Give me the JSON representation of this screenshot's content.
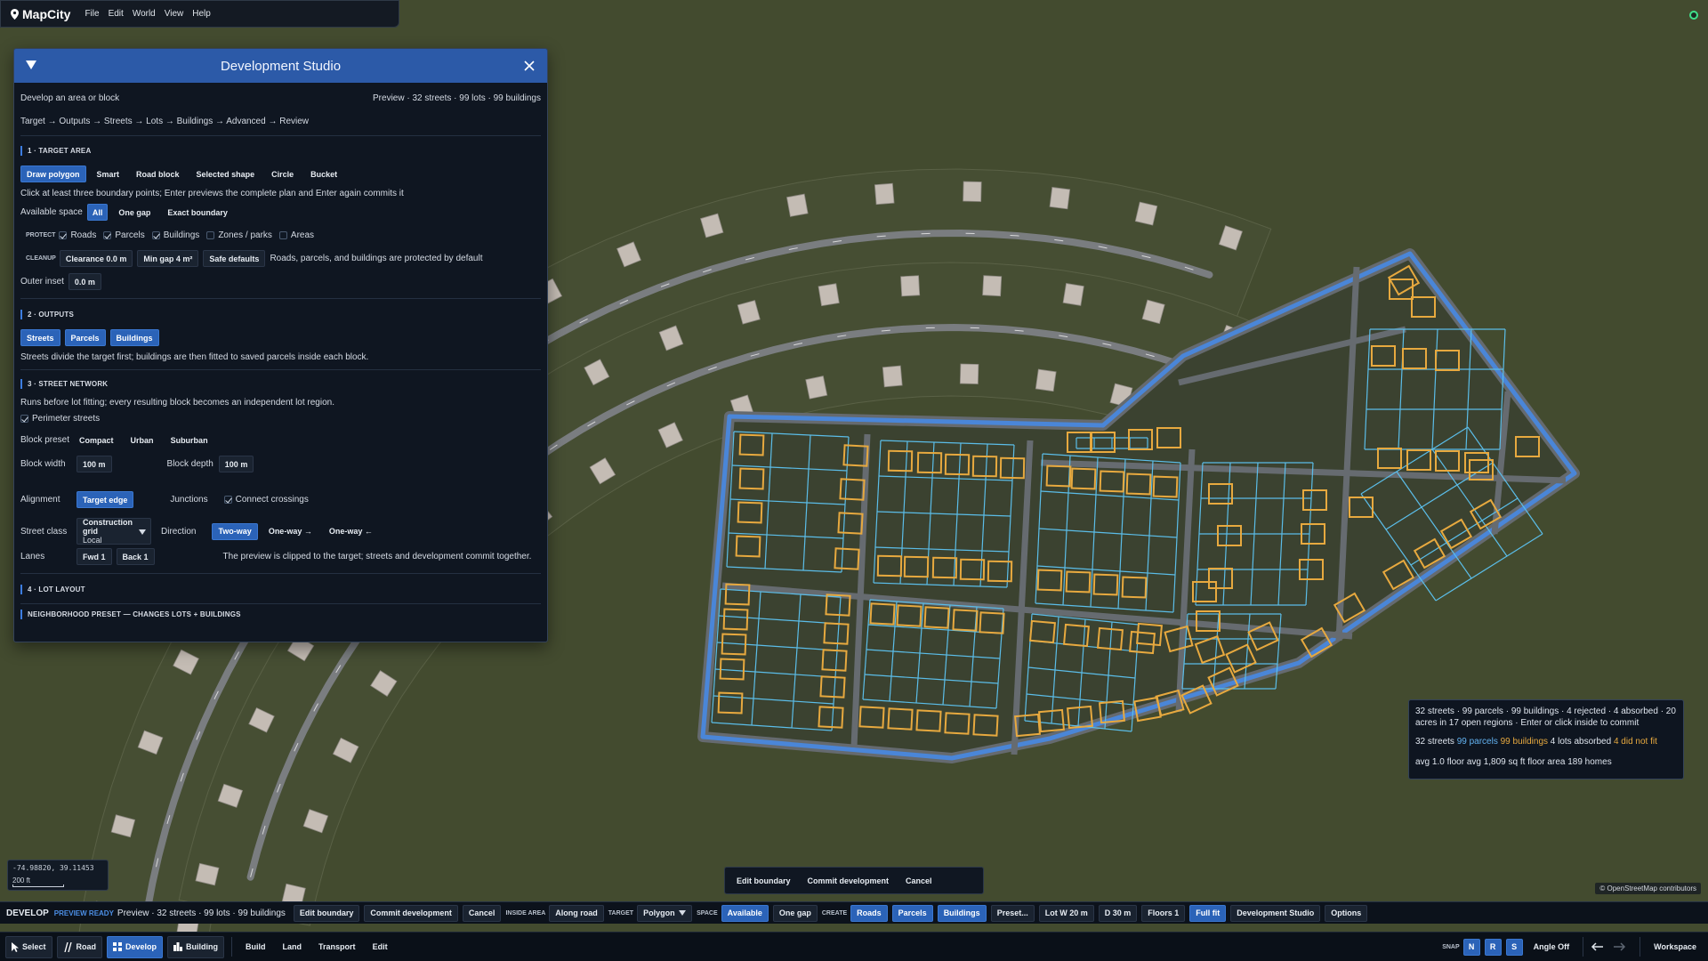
{
  "app": {
    "name": "MapCity",
    "menu": [
      "File",
      "Edit",
      "World",
      "View",
      "Help"
    ]
  },
  "panel": {
    "title": "Development Studio",
    "subtitle": "Develop an area or block",
    "preview": "Preview · 32 streets · 99 lots · 99 buildings",
    "steps": "Target → Outputs → Streets → Lots → Buildings → Advanced → Review",
    "target_area": {
      "title": "1 · TARGET AREA",
      "modes": [
        "Draw polygon",
        "Smart",
        "Road block",
        "Selected shape",
        "Circle",
        "Bucket"
      ],
      "hint": "Click at least three boundary points; Enter previews the complete plan and Enter again commits it",
      "available_space_label": "Available space",
      "available_space_options": [
        "All",
        "One gap",
        "Exact boundary"
      ],
      "protect_label": "PROTECT",
      "protect": [
        {
          "label": "Roads",
          "checked": true
        },
        {
          "label": "Parcels",
          "checked": true
        },
        {
          "label": "Buildings",
          "checked": true
        },
        {
          "label": "Zones / parks",
          "checked": false
        },
        {
          "label": "Areas",
          "checked": false
        }
      ],
      "cleanup_label": "CLEANUP",
      "cleanup_buttons": [
        "Clearance 0.0 m",
        "Min gap 4 m²",
        "Safe defaults"
      ],
      "cleanup_note": "Roads, parcels, and buildings are protected by default",
      "outer_inset_label": "Outer inset",
      "outer_inset_value": "0.0 m"
    },
    "outputs": {
      "title": "2 · OUTPUTS",
      "buttons": [
        "Streets",
        "Parcels",
        "Buildings"
      ],
      "note": "Streets divide the target first; buildings are then fitted to saved parcels inside each block."
    },
    "street_network": {
      "title": "3 · STREET NETWORK",
      "note": "Runs before lot fitting; every resulting block becomes an independent lot region.",
      "perimeter_label": "Perimeter streets",
      "block_preset_label": "Block preset",
      "block_presets": [
        "Compact",
        "Urban",
        "Suburban"
      ],
      "block_width_label": "Block width",
      "block_width_value": "100 m",
      "block_depth_label": "Block depth",
      "block_depth_value": "100 m",
      "alignment_label": "Alignment",
      "alignment_value": "Target edge",
      "junctions_label": "Junctions",
      "connect_crossings_label": "Connect crossings",
      "street_class_label": "Street class",
      "street_class_caption": "Construction grid",
      "street_class_value": "Local",
      "direction_label": "Direction",
      "directions": [
        "Two-way",
        "One-way →",
        "One-way ←"
      ],
      "lanes_label": "Lanes",
      "lanes": [
        "Fwd 1",
        "Back 1"
      ],
      "clip_note": "The preview is clipped to the target; streets and development commit together."
    },
    "lot_layout": {
      "title": "4 · LOT LAYOUT",
      "neighborhood_title": "NEIGHBORHOOD PRESET — CHANGES LOTS + BUILDINGS"
    }
  },
  "tooltip": {
    "line1": "32 streets · 99 parcels · 99 buildings · 4 rejected · 4 absorbed · 20 acres in 17 open regions · Enter or click inside to commit",
    "streets": "32 streets",
    "parcels": "99 parcels",
    "buildings": "99 buildings",
    "absorbed": "4 lots absorbed",
    "notfit": "4 did not fit",
    "line3": "avg 1.0 floor  avg 1,809 sq ft floor area  189 homes"
  },
  "commit_bar": [
    "Edit boundary",
    "Commit development",
    "Cancel"
  ],
  "coords": {
    "value": "-74.98820, 39.11453",
    "scale": "200 ft"
  },
  "attribution": "© OpenStreetMap contributors",
  "devbar": {
    "label": "DEVELOP",
    "ready": "PREVIEW READY",
    "summary": "Preview · 32 streets · 99 lots · 99 buildings",
    "edit": "Edit boundary",
    "commit": "Commit development",
    "cancel": "Cancel",
    "inside_area_label": "INSIDE AREA",
    "along_road": "Along road",
    "target_label": "TARGET",
    "target_value": "Polygon",
    "space_label": "SPACE",
    "available": "Available",
    "one_gap": "One gap",
    "create_label": "CREATE",
    "roads": "Roads",
    "parcels": "Parcels",
    "buildings": "Buildings",
    "preset": "Preset...",
    "lot_w": "Lot W 20 m",
    "d": "D 30 m",
    "floors": "Floors 1",
    "full_fit": "Full fit",
    "studio": "Development Studio",
    "options": "Options"
  },
  "toolbar": {
    "select": "Select",
    "road": "Road",
    "develop": "Develop",
    "building": "Building",
    "build": "Build",
    "land": "Land",
    "transport": "Transport",
    "edit": "Edit",
    "snap_label": "SNAP",
    "snap_n": "N",
    "snap_r": "R",
    "snap_s": "S",
    "angle": "Angle Off",
    "workspace": "Workspace"
  },
  "colors": {
    "terrain": "#434b2f",
    "accent": "#2b63b8",
    "boundary": "#4a86d8",
    "parcel": "#5bbde8",
    "building": "#e7a93f"
  }
}
